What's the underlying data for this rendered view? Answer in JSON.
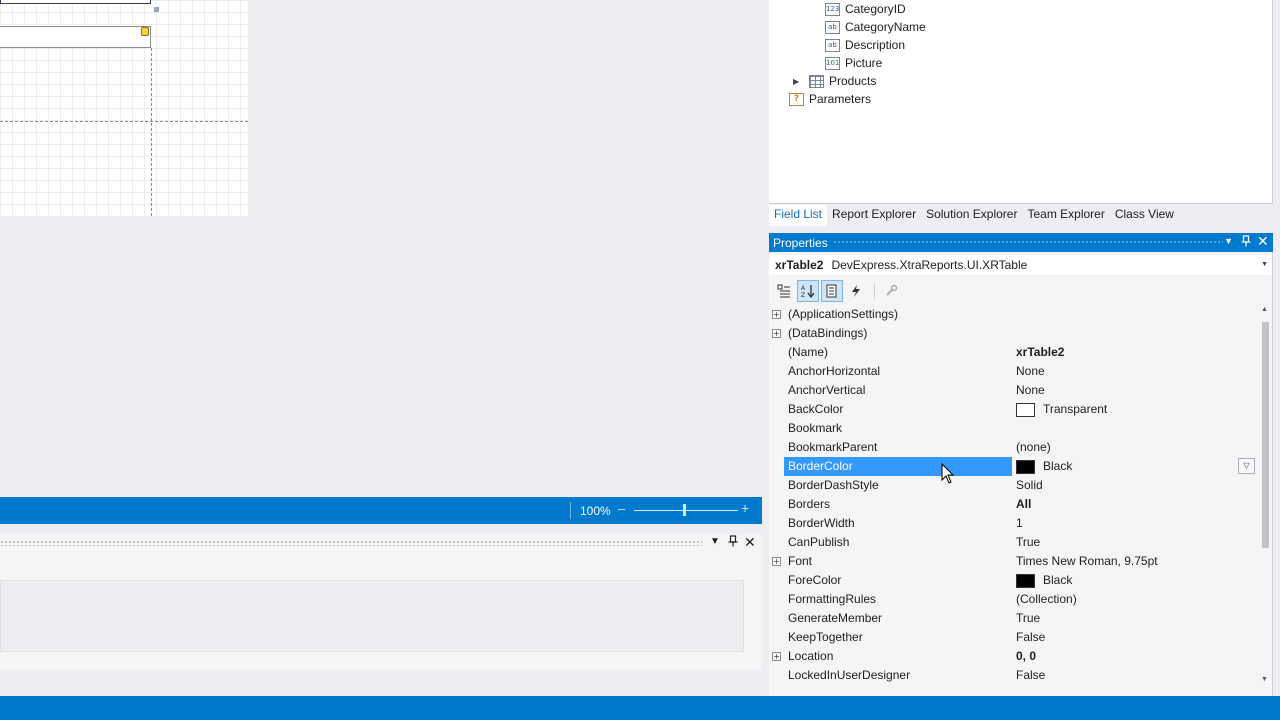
{
  "designer": {
    "zoom_value": "100%",
    "zoom_minus": "–",
    "zoom_plus": "+",
    "zoom_level": 0.48
  },
  "bottom_panel": {
    "dropdown_icon": "▼",
    "pin_icon": "pin-icon",
    "close_icon": "✕"
  },
  "field_list": {
    "items": [
      {
        "label": "CategoryID",
        "icon": "123"
      },
      {
        "label": "CategoryName",
        "icon": "ab"
      },
      {
        "label": "Description",
        "icon": "ab"
      },
      {
        "label": "Picture",
        "icon": "101"
      },
      {
        "label": "Products",
        "icon": "table-icon",
        "expander": "▶"
      },
      {
        "label": "Parameters",
        "icon": "?"
      }
    ]
  },
  "explorer_tabs": [
    "Field List",
    "Report Explorer",
    "Solution Explorer",
    "Team Explorer",
    "Class View"
  ],
  "properties": {
    "title": "Properties",
    "dropdown_icon": "▼",
    "close_icon": "✕",
    "object_name": "xrTable2",
    "object_type": "DevExpress.XtraReports.UI.XRTable",
    "rows": [
      {
        "name": "(ApplicationSettings)",
        "value": "",
        "expandable": true
      },
      {
        "name": "(DataBindings)",
        "value": "",
        "expandable": true
      },
      {
        "name": "(Name)",
        "value": "xrTable2",
        "bold": true
      },
      {
        "name": "AnchorHorizontal",
        "value": "None"
      },
      {
        "name": "AnchorVertical",
        "value": "None"
      },
      {
        "name": "BackColor",
        "value": "Transparent",
        "swatch": "#ffffff"
      },
      {
        "name": "Bookmark",
        "value": ""
      },
      {
        "name": "BookmarkParent",
        "value": "(none)"
      },
      {
        "name": "BorderColor",
        "value": "Black",
        "swatch": "#000000",
        "selected": true
      },
      {
        "name": "BorderDashStyle",
        "value": "Solid"
      },
      {
        "name": "Borders",
        "value": "All",
        "bold": true
      },
      {
        "name": "BorderWidth",
        "value": "1"
      },
      {
        "name": "CanPublish",
        "value": "True"
      },
      {
        "name": "Font",
        "value": "Times New Roman, 9.75pt",
        "expandable": true
      },
      {
        "name": "ForeColor",
        "value": "Black",
        "swatch": "#000000"
      },
      {
        "name": "FormattingRules",
        "value": "(Collection)"
      },
      {
        "name": "GenerateMember",
        "value": "True"
      },
      {
        "name": "KeepTogether",
        "value": "False"
      },
      {
        "name": "Location",
        "value": "0, 0",
        "bold": true,
        "expandable": true
      },
      {
        "name": "LockedInUserDesigner",
        "value": "False"
      }
    ]
  },
  "colors": {
    "accent": "#007acc",
    "selection": "#3399ff"
  }
}
